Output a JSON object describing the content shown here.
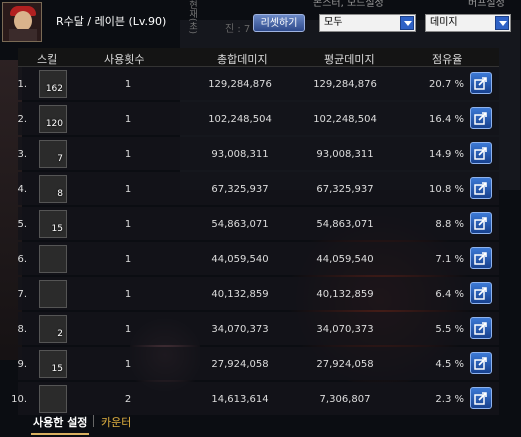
{
  "header": {
    "character": "R수달 / 레이븐 (Lv.90)",
    "vertical_tag": "현재(초)",
    "monster_label": "몬스터, 모드설정",
    "buff_label": "버프설정",
    "ghost_text": "진 : 7",
    "reset_label": "리셋하기",
    "target_select": "모두",
    "metric_select": "데미지"
  },
  "columns": {
    "skill": "스킬",
    "count": "사용횟수",
    "total": "총합데미지",
    "avg": "평균데미지",
    "share": "점유율"
  },
  "rows": [
    {
      "idx": "1.",
      "lvl": "162",
      "icon": "dark-slash-icon",
      "count": "1",
      "total": "129,284,876",
      "avg": "129,284,876",
      "share": "20.7 %"
    },
    {
      "idx": "2.",
      "lvl": "120",
      "icon": "blade-icon",
      "count": "1",
      "total": "102,248,504",
      "avg": "102,248,504",
      "share": "16.4 %"
    },
    {
      "idx": "3.",
      "lvl": "7",
      "icon": "swirl-icon",
      "count": "1",
      "total": "93,008,311",
      "avg": "93,008,311",
      "share": "14.9 %"
    },
    {
      "idx": "4.",
      "lvl": "8",
      "icon": "slash-icon",
      "count": "1",
      "total": "67,325,937",
      "avg": "67,325,937",
      "share": "10.8 %"
    },
    {
      "idx": "5.",
      "lvl": "15",
      "icon": "spin-icon",
      "count": "1",
      "total": "54,863,071",
      "avg": "54,863,071",
      "share": "8.8 %"
    },
    {
      "idx": "6.",
      "lvl": "",
      "icon": "burst-icon",
      "count": "1",
      "total": "44,059,540",
      "avg": "44,059,540",
      "share": "7.1 %"
    },
    {
      "idx": "7.",
      "lvl": "",
      "icon": "spark-icon",
      "count": "1",
      "total": "40,132,859",
      "avg": "40,132,859",
      "share": "6.4 %"
    },
    {
      "idx": "8.",
      "lvl": "2",
      "icon": "cross-blade-icon",
      "count": "1",
      "total": "34,070,373",
      "avg": "34,070,373",
      "share": "5.5 %"
    },
    {
      "idx": "9.",
      "lvl": "15",
      "icon": "hook-icon",
      "count": "1",
      "total": "27,924,058",
      "avg": "27,924,058",
      "share": "4.5 %"
    },
    {
      "idx": "10.",
      "lvl": "",
      "icon": "gold-emblem-icon",
      "count": "2",
      "total": "14,613,614",
      "avg": "7,306,807",
      "share": "2.3 %"
    }
  ],
  "footer": {
    "tab_used": "사용한 설정",
    "tab_counter": "카운터"
  },
  "colors": {
    "accent_button": "#2f62c6",
    "active_tab_text": "#ffffff",
    "inactive_tab_text": "#e0b040"
  }
}
